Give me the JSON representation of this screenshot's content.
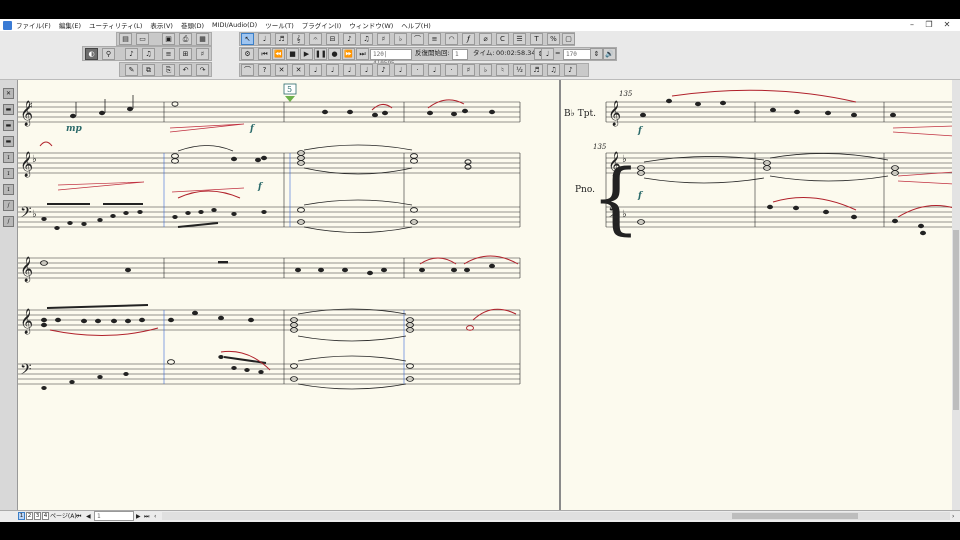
{
  "menubar": {
    "items": [
      "ファイル(F)",
      "編集(E)",
      "ユーティリティ(L)",
      "表示(V)",
      "巻頭(D)",
      "MIDI/Audio(D)",
      "ツール(T)",
      "プラグイン(I)",
      "ウィンドウ(W)",
      "ヘルプ(H)"
    ]
  },
  "playback": {
    "counter": "120| 4|0595",
    "start_label": "反復開始回:",
    "start_value": "1",
    "time_label": "タイム:",
    "time_value": "00:02:58.349",
    "tempo_eq": "=",
    "tempo_value": "170"
  },
  "score_left": {
    "measure_marker": "5",
    "dynamics": [
      "mp",
      "f",
      "f"
    ]
  },
  "score_right": {
    "measure_number_top": "135",
    "measure_number_bottom": "135",
    "trumpet_label": "B♭ Tpt.",
    "piano_label": "Pno.",
    "dynamics": [
      "f",
      "f"
    ]
  },
  "statusbar": {
    "pages": [
      "1",
      "2",
      "3",
      "4"
    ],
    "page_label": "ページ(A):",
    "page_value": "1"
  },
  "colors": {
    "paper": "#fcfaee",
    "slur_red": "#b0202a",
    "accent_teal": "#2b6a6a",
    "barline_blue": "#3a6ad8"
  }
}
